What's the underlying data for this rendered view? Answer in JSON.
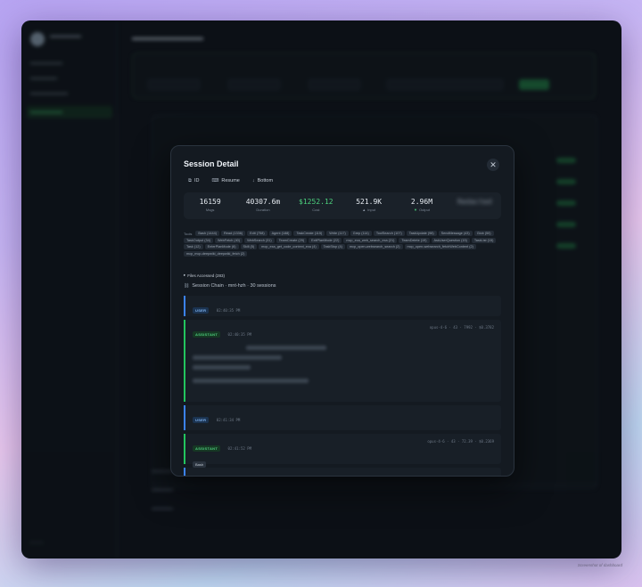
{
  "modal": {
    "title": "Session Detail",
    "close_glyph": "✕",
    "toolbar": [
      {
        "label": "ID",
        "icon": "copy-icon",
        "glyph": "⧉"
      },
      {
        "label": "Resume",
        "icon": "terminal-icon",
        "glyph": "⌨"
      },
      {
        "label": "Bottom",
        "icon": "arrow-down-icon",
        "glyph": "↓"
      }
    ],
    "stats": [
      {
        "value": "16159",
        "label": "Msgs"
      },
      {
        "value": "40307.6m",
        "label": "Duration"
      },
      {
        "value": "$1252.12",
        "label": "Cost"
      },
      {
        "value": "521.9K",
        "label": "Input",
        "arrow": "▲"
      },
      {
        "value": "2.96M",
        "label": "Output",
        "arrow": "▼"
      },
      {
        "value": "Redacted",
        "label": ""
      }
    ],
    "tools_label": "Tools",
    "tools": [
      "Bash (1444)",
      "Read (1336)",
      "Edit (758)",
      "Agent (188)",
      "TaskCreate (115)",
      "Write (117)",
      "Grep (114)",
      "ToolSearch (107)",
      "TaskUpdate (98)",
      "SendMessage (43)",
      "Glob (50)",
      "TaskOutput (34)",
      "WebFetch (40)",
      "WebSearch (31)",
      "TeamCreate (29)",
      "ExitPlanMode (22)",
      "mcp_exa_web_search_exa (21)",
      "TeamDelete (19)",
      "AskUserQuestion (15)",
      "TaskList (15)",
      "Task (12)",
      "EnterPlanMode (6)",
      "Skill (5)",
      "mcp_exa_get_code_context_exa (4)",
      "TaskStop (4)",
      "mcp_open-websearch_search (2)",
      "mcp_open-websearch_fetchWebContent (2)",
      "mcp_mcp-deepwiki_deepwiki_fetch (2)"
    ],
    "files_label": "Files Accessed (283)",
    "files_arrow": "▸",
    "chain_label": "Session Chain · mnt-hzh · 30 sessions",
    "chain_glyph": "⛓",
    "messages": [
      {
        "role": "USER",
        "time": "02:40:35 PM"
      },
      {
        "role": "ASSISTANT",
        "time": "02:40:35 PM",
        "meta": "opus-4-6 · 43 · 7992 · $0.3782"
      },
      {
        "role": "USER",
        "time": "02:41:34 PM"
      },
      {
        "role": "ASSISTANT",
        "time": "02:41:52 PM",
        "meta": "opus-4-6 · 43 · 72.39 · $0.2369",
        "tool": "Bash"
      }
    ]
  },
  "caption": "Screenshot of dashboard"
}
